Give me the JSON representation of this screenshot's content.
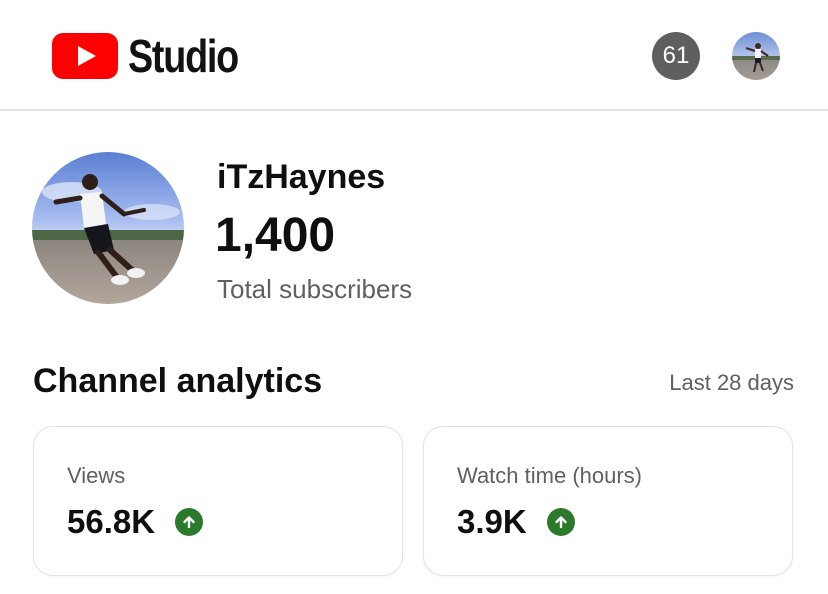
{
  "header": {
    "logo_text": "Studio",
    "notification_count": "61",
    "brand_red": "#ff0000"
  },
  "channel": {
    "name": "iTzHaynes",
    "subscriber_count": "1,400",
    "subscriber_label": "Total subscribers"
  },
  "analytics": {
    "title": "Channel analytics",
    "range": "Last 28 days",
    "cards": [
      {
        "label": "Views",
        "value": "56.8K",
        "trend": "up",
        "trend_icon": "arrow-up-icon"
      },
      {
        "label": "Watch time (hours)",
        "value": "3.9K",
        "trend": "up",
        "trend_icon": "arrow-up-icon"
      }
    ],
    "trend_up_color": "#2b7a2b"
  }
}
